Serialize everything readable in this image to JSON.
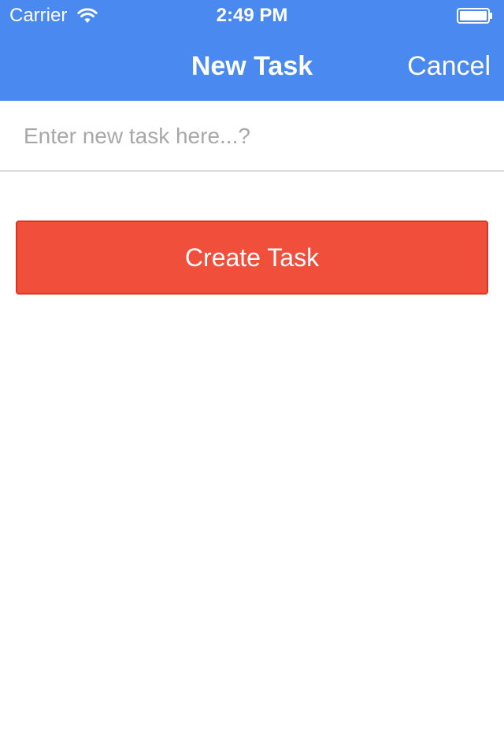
{
  "status_bar": {
    "carrier": "Carrier",
    "time": "2:49 PM",
    "wifi_icon": "wifi-icon",
    "battery_icon": "battery-icon"
  },
  "nav": {
    "title": "New Task",
    "cancel_label": "Cancel"
  },
  "form": {
    "task_input": {
      "value": "",
      "placeholder": "Enter new task here...?"
    },
    "create_button_label": "Create Task"
  },
  "colors": {
    "nav_background": "#4a89ef",
    "button_background": "#f04f3b",
    "button_border": "#d9361f",
    "placeholder_text": "#a8a8a8",
    "divider": "#d9d9d9"
  }
}
